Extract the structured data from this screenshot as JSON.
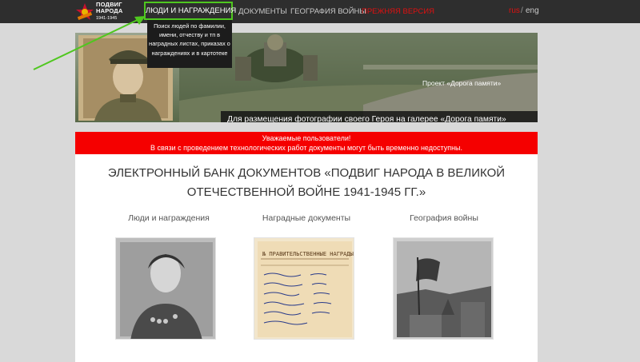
{
  "logo": {
    "line1": "ПОДВИГ",
    "line2": "НАРОДА",
    "years": "1941-1945"
  },
  "nav": {
    "items": [
      {
        "label": "Люди и награждения"
      },
      {
        "label": "Документы"
      },
      {
        "label": "География войны"
      },
      {
        "label": "Прежняя версия"
      }
    ],
    "lang_rus": "rus",
    "lang_sep": "/",
    "lang_eng": "eng"
  },
  "tooltip": {
    "text": "Поиск людей по фамилии, имени, отчеству и тп в наградных листах, приказах о награждениях и в картотеке"
  },
  "banner": {
    "project": "Проект «Дорога памяти»",
    "caption": "Для размещения фотографии своего Героя на галерее «Дорога памяти» Главного храма Вооруженных Сил России, перейдите на страницу Героя и воспользуйтесь баннером – «Добавить фотографию героя»"
  },
  "alert": {
    "line1": "Уважаемые пользователи!",
    "line2": "В связи с проведением технологических работ документы могут быть временно недоступны."
  },
  "main": {
    "title": "ЭЛЕКТРОННЫЙ БАНК ДОКУМЕНТОВ «ПОДВИГ НАРОДА В ВЕЛИКОЙ ОТЕЧЕСТВЕННОЙ ВОЙНЕ 1941-1945 ГГ.»",
    "sections": [
      {
        "label": "Люди и награждения"
      },
      {
        "label": "Наградные документы"
      },
      {
        "label": "География войны"
      }
    ],
    "doc_header": "№ ПРАВИТЕЛЬСТВЕННЫЕ НАГРАДЫ"
  },
  "colors": {
    "nav_bg": "#2e2e2e",
    "active_border": "#4fc71f",
    "alert_bg": "#f50000",
    "old_version": "#e01010"
  }
}
